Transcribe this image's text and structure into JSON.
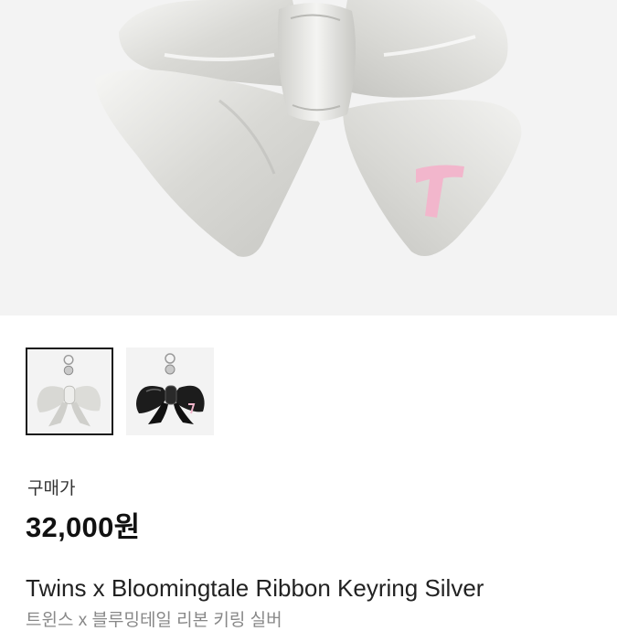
{
  "colors": {
    "hero_background": "#f3f3f3",
    "bow_silver": "#dcdcd8",
    "bow_black": "#1c1c1c",
    "letter_pink": "#f2b6cc",
    "selected_border": "#1a1a1a"
  },
  "gallery": {
    "thumbnails": [
      {
        "name": "silver",
        "selected": true
      },
      {
        "name": "black",
        "selected": false
      }
    ]
  },
  "product": {
    "price_label": "구매가",
    "price": "32,000원",
    "title": "Twins x Bloomingtale Ribbon Keyring Silver",
    "subtitle": "트윈스 x 블루밍테일 리본 키링 실버"
  }
}
